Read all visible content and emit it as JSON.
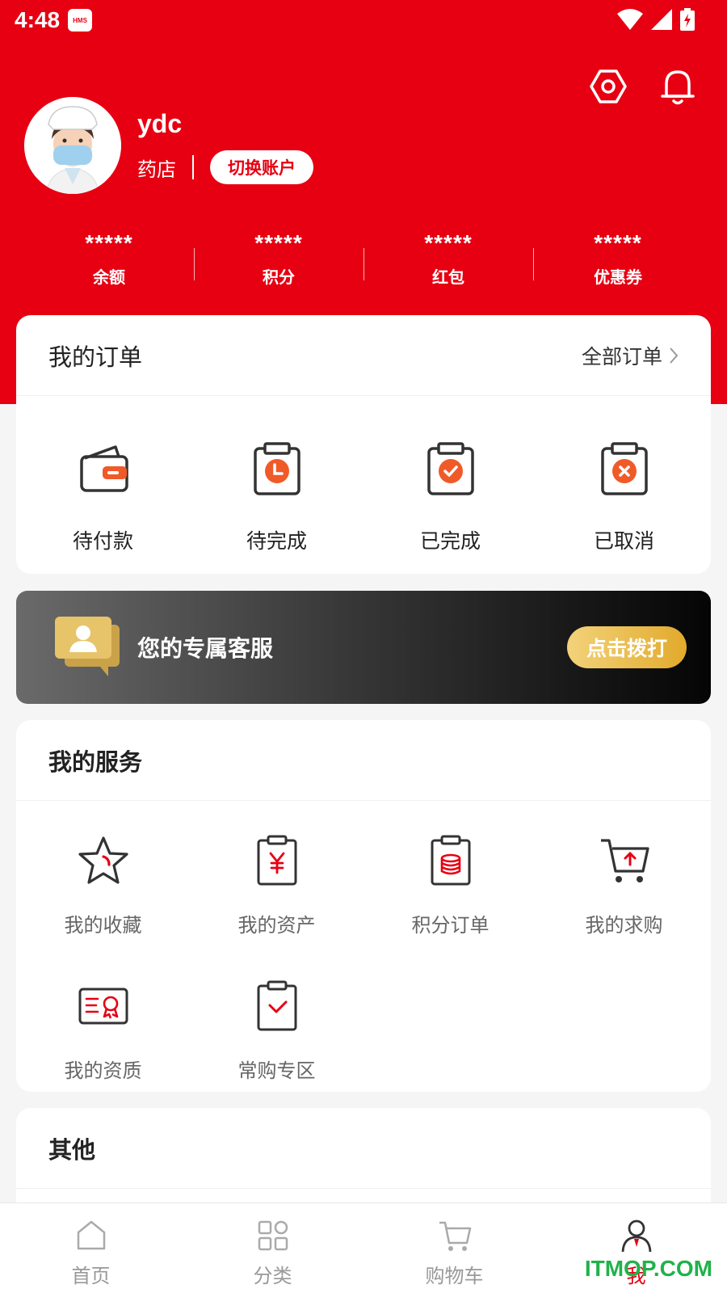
{
  "colors": {
    "brand_red": "#e60012",
    "gold": "#e8b23b",
    "orange": "#f05a28"
  },
  "status_bar": {
    "time": "4:48",
    "hms_badge": "HMS"
  },
  "profile": {
    "username": "ydc",
    "store_type": "药店",
    "switch_account_label": "切换账户"
  },
  "stats": [
    {
      "value": "*****",
      "label": "余额"
    },
    {
      "value": "*****",
      "label": "积分"
    },
    {
      "value": "*****",
      "label": "红包"
    },
    {
      "value": "*****",
      "label": "优惠券"
    }
  ],
  "orders": {
    "title": "我的订单",
    "all_label": "全部订单",
    "items": [
      {
        "label": "待付款",
        "icon": "wallet-icon"
      },
      {
        "label": "待完成",
        "icon": "clock-clipboard-icon"
      },
      {
        "label": "已完成",
        "icon": "check-clipboard-icon"
      },
      {
        "label": "已取消",
        "icon": "cancel-clipboard-icon"
      }
    ]
  },
  "service_banner": {
    "text": "您的专属客服",
    "button_label": "点击拨打"
  },
  "services": {
    "title": "我的服务",
    "items": [
      {
        "label": "我的收藏",
        "icon": "star-icon"
      },
      {
        "label": "我的资产",
        "icon": "yuan-clipboard-icon"
      },
      {
        "label": "积分订单",
        "icon": "coins-clipboard-icon"
      },
      {
        "label": "我的求购",
        "icon": "cart-upload-icon"
      },
      {
        "label": "我的资质",
        "icon": "certificate-icon"
      },
      {
        "label": "常购专区",
        "icon": "check-clipboard-icon"
      }
    ]
  },
  "other": {
    "title": "其他"
  },
  "tabbar": [
    {
      "label": "首页",
      "icon": "home-icon"
    },
    {
      "label": "分类",
      "icon": "grid-icon"
    },
    {
      "label": "购物车",
      "icon": "cart-icon"
    },
    {
      "label": "我",
      "icon": "person-icon",
      "active": true
    }
  ],
  "watermark": "ITMOP.COM"
}
